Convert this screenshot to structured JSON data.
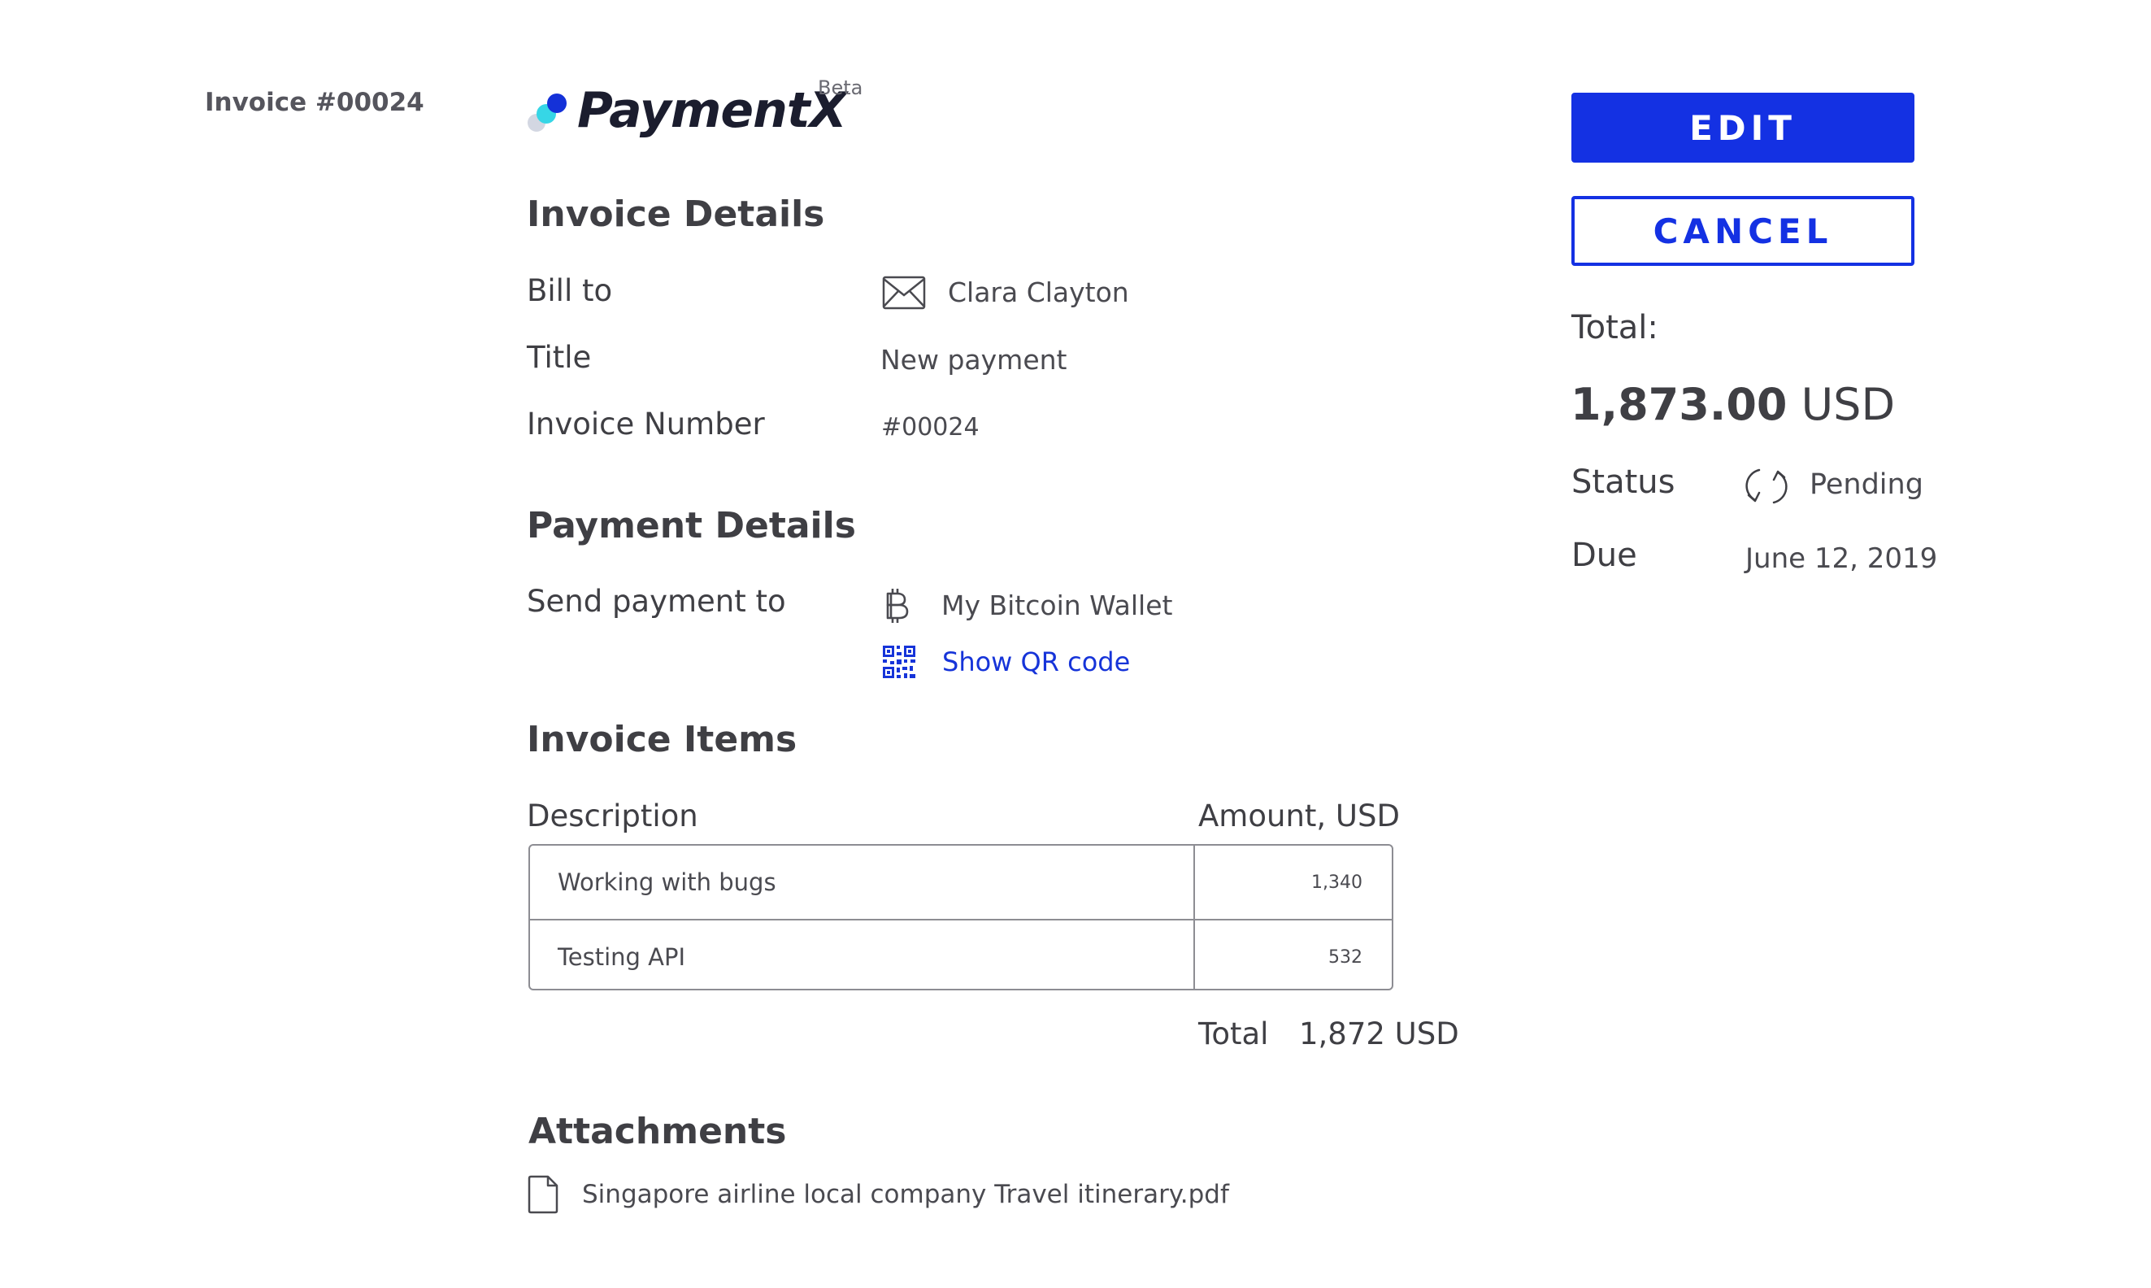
{
  "sidebar": {
    "invoice_label": "Invoice #00024"
  },
  "brand": {
    "name": "PaymentX",
    "badge": "Beta"
  },
  "invoice_details": {
    "heading": "Invoice Details",
    "bill_to_label": "Bill to",
    "bill_to_value": "Clara Clayton",
    "title_label": "Title",
    "title_value": "New payment",
    "number_label": "Invoice Number",
    "number_value": "#00024"
  },
  "payment_details": {
    "heading": "Payment Details",
    "send_label": "Send payment to",
    "wallet_name": "My Bitcoin Wallet",
    "qr_link": "Show QR code"
  },
  "invoice_items": {
    "heading": "Invoice Items",
    "columns": [
      "Description",
      "Amount, USD"
    ],
    "rows": [
      {
        "description": "Working with bugs",
        "amount": "1,340"
      },
      {
        "description": "Testing API",
        "amount": "532"
      }
    ],
    "total_label": "Total",
    "total_value": "1,872 USD"
  },
  "attachments": {
    "heading": "Attachments",
    "files": [
      "Singapore airline local company Travel itinerary.pdf"
    ]
  },
  "actions": {
    "edit_label": "EDIT",
    "cancel_label": "CANCEL"
  },
  "summary": {
    "total_label": "Total:",
    "total_amount": "1,873.00",
    "total_currency": "USD",
    "status_label": "Status",
    "status_value": "Pending",
    "due_label": "Due",
    "due_value": "June 12, 2019"
  },
  "colors": {
    "accent": "#1431e3",
    "link": "#1634d9",
    "text": "#3f3f44",
    "logo_dot_dark": "#1431d8",
    "logo_dot_cyan": "#36d6e6",
    "logo_dot_light": "#d3d7e2"
  },
  "icons": {
    "bill_to": "envelope-icon",
    "wallet": "bitcoin-icon",
    "qr": "qr-code-icon",
    "status": "refresh-icon",
    "attachment": "file-icon"
  }
}
